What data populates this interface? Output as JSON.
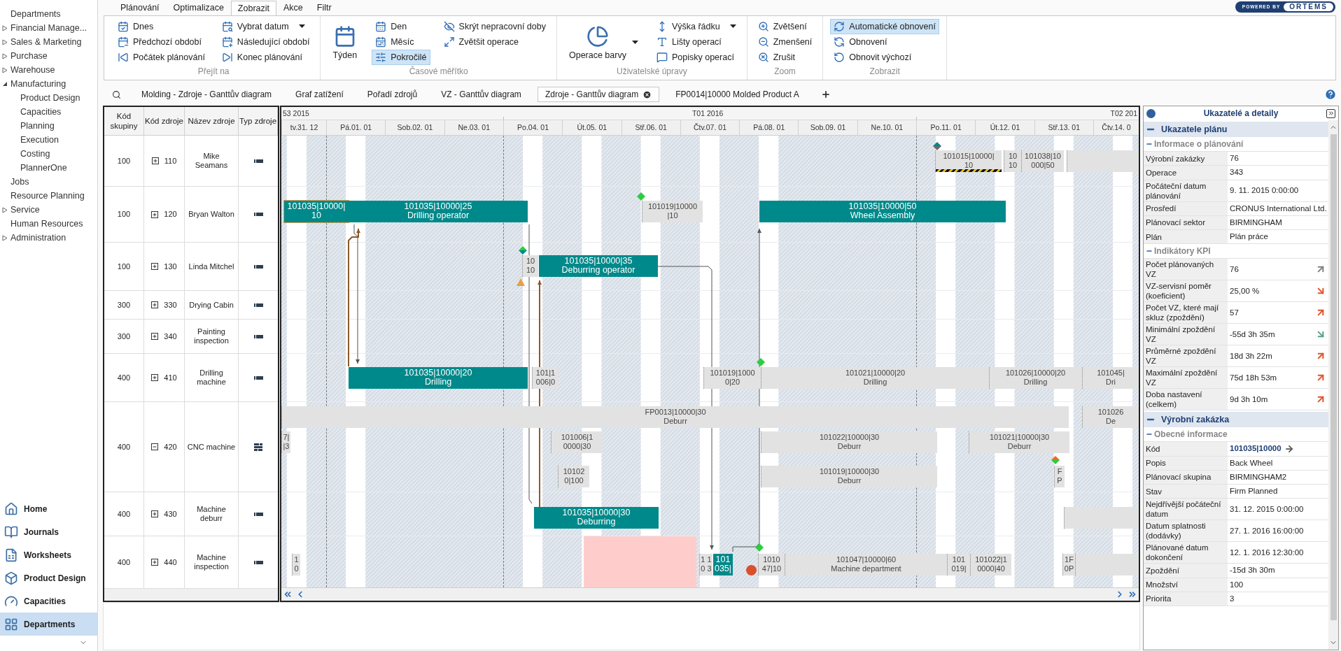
{
  "sidebar": {
    "items": [
      {
        "label": "Departments"
      },
      {
        "label": "Financial Manage...",
        "expanded": false
      },
      {
        "label": "Sales & Marketing",
        "expanded": false
      },
      {
        "label": "Purchase",
        "expanded": false
      },
      {
        "label": "Warehouse",
        "expanded": false
      },
      {
        "label": "Manufacturing",
        "expanded": true,
        "children": [
          {
            "label": "Product Design"
          },
          {
            "label": "Capacities"
          },
          {
            "label": "Planning"
          },
          {
            "label": "Execution"
          },
          {
            "label": "Costing"
          },
          {
            "label": "PlannerOne"
          }
        ]
      },
      {
        "label": "Jobs"
      },
      {
        "label": "Resource Planning"
      },
      {
        "label": "Service",
        "expanded": false
      },
      {
        "label": "Human Resources"
      },
      {
        "label": "Administration",
        "expanded": false
      }
    ],
    "nav_buttons": [
      {
        "label": "Home",
        "selected": false
      },
      {
        "label": "Journals",
        "selected": false
      },
      {
        "label": "Worksheets",
        "selected": false
      },
      {
        "label": "Product Design",
        "selected": false
      },
      {
        "label": "Capacities",
        "selected": false
      },
      {
        "label": "Departments",
        "selected": true
      }
    ]
  },
  "ribbon": {
    "tabs": [
      {
        "label": "Plánování",
        "selected": false
      },
      {
        "label": "Optimalizace",
        "selected": false
      },
      {
        "label": "Zobrazit",
        "selected": true
      },
      {
        "label": "Akce",
        "selected": false
      },
      {
        "label": "Filtr",
        "selected": false
      }
    ],
    "logo": {
      "tagline": "POWERED BY",
      "brand": "ORTEMS"
    },
    "groups": [
      {
        "title": "Přejít na",
        "items": [
          {
            "label": "Dnes",
            "kind": "small",
            "selected": false,
            "dropdown": false
          },
          {
            "label": "Předchozí období",
            "kind": "small",
            "selected": false,
            "dropdown": false
          },
          {
            "label": "Počátek plánování",
            "kind": "small",
            "selected": false,
            "dropdown": false
          },
          {
            "label": "Vybrat datum",
            "kind": "small",
            "selected": false,
            "dropdown": true
          },
          {
            "label": "Následující období",
            "kind": "small",
            "selected": false,
            "dropdown": false
          },
          {
            "label": "Konec plánování",
            "kind": "small",
            "selected": false,
            "dropdown": false
          }
        ]
      },
      {
        "title": "Časové měřítko",
        "items": [
          {
            "label": "Týden",
            "kind": "large",
            "selected": false,
            "dropdown": false
          },
          {
            "label": "Den",
            "kind": "small",
            "selected": false,
            "dropdown": false
          },
          {
            "label": "Měsíc",
            "kind": "small",
            "selected": false,
            "dropdown": false
          },
          {
            "label": "Pokročilé",
            "kind": "small",
            "selected": true,
            "dropdown": false
          },
          {
            "label": "Skrýt nepracovní doby",
            "kind": "small",
            "selected": false,
            "dropdown": false
          },
          {
            "label": "Zvětšit operace",
            "kind": "small",
            "selected": false,
            "dropdown": false
          }
        ]
      },
      {
        "title": "Uživatelské úpravy",
        "items": [
          {
            "label": "Operace barvy",
            "kind": "large",
            "selected": false,
            "dropdown": true
          },
          {
            "label": "Výška řádku",
            "kind": "small",
            "selected": false,
            "dropdown": true
          },
          {
            "label": "Lišty operací",
            "kind": "small",
            "selected": false,
            "dropdown": false
          },
          {
            "label": "Popisky operací",
            "kind": "small",
            "selected": false,
            "dropdown": false
          }
        ]
      },
      {
        "title": "Zoom",
        "items": [
          {
            "label": "Zvětšení",
            "kind": "small",
            "selected": false,
            "dropdown": false
          },
          {
            "label": "Zmenšení",
            "kind": "small",
            "selected": false,
            "dropdown": false
          },
          {
            "label": "Zrušit",
            "kind": "small",
            "selected": false,
            "dropdown": false
          }
        ]
      },
      {
        "title": "Zobrazit",
        "items": [
          {
            "label": "Automatické obnovení",
            "kind": "small",
            "selected": true,
            "dropdown": false
          },
          {
            "label": "Obnovení",
            "kind": "small",
            "selected": false,
            "dropdown": false
          },
          {
            "label": "Obnovit výchozí",
            "kind": "small",
            "selected": false,
            "dropdown": false
          }
        ]
      }
    ]
  },
  "doc_tabs": [
    {
      "label": "Molding - Zdroje - Ganttův diagram",
      "selected": false
    },
    {
      "label": "Graf zatížení",
      "selected": false
    },
    {
      "label": "Pořadí zdrojů",
      "selected": false
    },
    {
      "label": "VZ - Ganttův diagram",
      "selected": false
    },
    {
      "label": "Zdroje - Ganttův diagram",
      "selected": true
    },
    {
      "label": "FP0014|10000 Molded Product A",
      "selected": false
    }
  ],
  "gantt": {
    "columns": [
      "Kód skupiny",
      "Kód zdroje",
      "Název zdroje",
      "Typ zdroje"
    ],
    "weeks": [
      "53 2015",
      "T01 2016",
      "T02 201"
    ],
    "days": [
      "tv.31. 12",
      "Pá.01. 01",
      "Sob.02. 01",
      "Ne.03. 01",
      "Po.04. 01",
      "Út.05. 01",
      "Stř.06. 01",
      "Čtv.07. 01",
      "Pá.08. 01",
      "Sob.09. 01",
      "Ne.10. 01",
      "Po.11. 01",
      "Út.12. 01",
      "Stř.13. 01",
      "Čtv.14. 0"
    ],
    "rows": [
      {
        "group": "100",
        "code": "110",
        "name": "Mike Seamans",
        "kind": "single",
        "expanded": false,
        "bars": [
          {
            "lines": [
              "101015|10000|",
              "10"
            ],
            "kind": "other",
            "selected": false,
            "delayed": true
          },
          {
            "lines": [
              "10",
              "10"
            ],
            "kind": "other",
            "selected": false,
            "delayed": false
          },
          {
            "lines": [
              "101038|10",
              "000|50"
            ],
            "kind": "other",
            "selected": false,
            "delayed": false
          },
          {
            "kind": "other",
            "selected": false,
            "delayed": false
          }
        ]
      },
      {
        "group": "100",
        "code": "120",
        "name": "Bryan Walton",
        "kind": "single",
        "expanded": false,
        "bars": [
          {
            "lines": [
              "101035|10000|",
              "10"
            ],
            "kind": "order",
            "selected": true,
            "delayed": false
          },
          {
            "lines": [
              "101035|10000|25",
              "Drilling operator"
            ],
            "kind": "order",
            "selected": false,
            "delayed": false
          },
          {
            "lines": [
              "101019|10000",
              "|10"
            ],
            "kind": "other",
            "selected": false,
            "delayed": false
          },
          {
            "lines": [
              "101035|10000|50",
              "Wheel Assembly"
            ],
            "kind": "order",
            "selected": false,
            "delayed": false
          }
        ]
      },
      {
        "group": "100",
        "code": "130",
        "name": "Linda Mitchel",
        "kind": "single",
        "expanded": false,
        "bars": [
          {
            "lines": [
              "10",
              "10"
            ],
            "kind": "other",
            "selected": false,
            "delayed": false
          },
          {
            "lines": [
              "101035|10000|35",
              "Deburring operator"
            ],
            "kind": "order",
            "selected": false,
            "delayed": false
          }
        ]
      },
      {
        "group": "300",
        "code": "330",
        "name": "Drying Cabin",
        "kind": "single",
        "expanded": false
      },
      {
        "group": "300",
        "code": "340",
        "name": "Painting inspection",
        "kind": "single",
        "expanded": false
      },
      {
        "group": "400",
        "code": "410",
        "name": "Drilling machine",
        "kind": "single",
        "expanded": false,
        "bars": [
          {
            "lines": [
              "101035|10000|20",
              "Drilling"
            ],
            "kind": "order",
            "selected": false,
            "delayed": false
          },
          {
            "lines": [
              "101|1",
              "006|0"
            ],
            "kind": "other",
            "selected": false,
            "delayed": false
          },
          {
            "lines": [
              "101019|1000",
              "0|20"
            ],
            "kind": "other",
            "selected": false,
            "delayed": false
          },
          {
            "lines": [
              "101021|10000|20",
              "Drilling"
            ],
            "kind": "other",
            "selected": false,
            "delayed": false
          },
          {
            "lines": [
              "101026|10000|20",
              "Drilling"
            ],
            "kind": "other",
            "selected": false,
            "delayed": false
          },
          {
            "lines": [
              "101045|",
              "Dri"
            ],
            "kind": "other",
            "selected": false,
            "delayed": false
          }
        ]
      },
      {
        "group": "400",
        "code": "420",
        "name": "CNC machine",
        "kind": "multiple",
        "expanded": true,
        "bars": [
          {
            "lines": [
              "FP0013|10000|30",
              "Deburr"
            ],
            "kind": "other",
            "selected": false,
            "delayed": false
          },
          {
            "lines": [
              "101026",
              "De"
            ],
            "kind": "other",
            "selected": false,
            "delayed": false
          },
          {
            "lines": [
              "7|",
              "|3"
            ],
            "kind": "other",
            "selected": false,
            "delayed": false
          },
          {
            "lines": [
              "101006|1",
              "0000|30"
            ],
            "kind": "other",
            "selected": false,
            "delayed": false
          },
          {
            "lines": [
              "101022|10000|30",
              "Deburr"
            ],
            "kind": "other",
            "selected": false,
            "delayed": false
          },
          {
            "lines": [
              "101021|10000|30",
              "Deburr"
            ],
            "kind": "other",
            "selected": false,
            "delayed": false
          },
          {
            "lines": [
              "10102",
              "0|100"
            ],
            "kind": "other",
            "selected": false,
            "delayed": false
          },
          {
            "lines": [
              "101019|10000|30",
              "Deburr"
            ],
            "kind": "other",
            "selected": false,
            "delayed": false
          },
          {
            "lines": [
              "F",
              "P"
            ],
            "kind": "other",
            "selected": false,
            "delayed": false
          }
        ]
      },
      {
        "group": "400",
        "code": "430",
        "name": "Machine deburr",
        "kind": "single",
        "expanded": false,
        "bars": [
          {
            "lines": [
              "101035|10000|30",
              "Deburring"
            ],
            "kind": "order",
            "selected": false,
            "delayed": false
          },
          {
            "kind": "other",
            "selected": false,
            "delayed": false
          }
        ]
      },
      {
        "group": "400",
        "code": "440",
        "name": "Machine inspection",
        "kind": "single",
        "expanded": false,
        "bars": [
          {
            "lines": [
              "1",
              "0"
            ],
            "kind": "other",
            "selected": false,
            "delayed": false
          },
          {
            "lines": [
              "1 1",
              "0 3"
            ],
            "kind": "other",
            "selected": false,
            "delayed": false
          },
          {
            "lines": [
              "101",
              "035|"
            ],
            "kind": "order",
            "selected": false,
            "delayed": false
          },
          {
            "lines": [
              "1010",
              "47|10"
            ],
            "kind": "other",
            "selected": false,
            "delayed": false
          },
          {
            "lines": [
              "101047|10000|60",
              "Machine department"
            ],
            "kind": "other",
            "selected": false,
            "delayed": false
          },
          {
            "lines": [
              "101",
              "019|"
            ],
            "kind": "other",
            "selected": false,
            "delayed": false
          },
          {
            "lines": [
              "101022|1",
              "0000|40"
            ],
            "kind": "other",
            "selected": false,
            "delayed": false
          },
          {
            "lines": [
              "1F",
              "0P"
            ],
            "kind": "other",
            "selected": false,
            "delayed": false
          },
          {
            "kind": "other",
            "selected": false,
            "delayed": false
          }
        ]
      }
    ]
  },
  "details_panel": {
    "title": "Ukazatelé a detaily",
    "sections": [
      {
        "title": "Ukazatele plánu",
        "groups": [
          {
            "title": "Informace o plánování",
            "rows": [
              {
                "label": "Výrobní zakázky",
                "value": "76",
                "kind": "text"
              },
              {
                "label": "Operace",
                "value": "343",
                "kind": "text"
              },
              {
                "label": "Počáteční datum plánování",
                "value": "9. 11. 2015 0:00:00",
                "kind": "text"
              },
              {
                "label": "Prosředí",
                "value": "CRONUS International Ltd.",
                "kind": "text"
              },
              {
                "label": "Plánovací sektor",
                "value": "BIRMINGHAM",
                "kind": "text"
              },
              {
                "label": "Plán",
                "value": "Plán práce",
                "kind": "text"
              }
            ]
          },
          {
            "title": "Indikátory KPI",
            "rows": [
              {
                "label": "Počet plánovaných VZ",
                "value": "76",
                "kind": "kpi",
                "rising": true,
                "color": "#808080"
              },
              {
                "label": "VZ-servisní poměr (koeficient)",
                "value": "25,00 %",
                "kind": "kpi",
                "rising": false,
                "color": "#e0522a"
              },
              {
                "label": "Počet VZ, které mají skluz (zpoždění)",
                "value": "57",
                "kind": "kpi",
                "rising": true,
                "color": "#e0522a"
              },
              {
                "label": "Minimální zpoždění VZ",
                "value": "-55d 3h 35m",
                "kind": "kpi",
                "rising": false,
                "color": "#5a9e83"
              },
              {
                "label": "Průměrné zpoždění VZ",
                "value": "18d 3h 22m",
                "kind": "kpi",
                "rising": true,
                "color": "#e0522a"
              },
              {
                "label": "Maximální zpoždění VZ",
                "value": "75d 18h 53m",
                "kind": "kpi",
                "rising": true,
                "color": "#e0522a"
              },
              {
                "label": "Doba nastavení (celkem)",
                "value": "9d 3h 10m",
                "kind": "kpi",
                "rising": true,
                "color": "#e0522a"
              }
            ]
          }
        ]
      },
      {
        "title": "Výrobní zakázka",
        "groups": [
          {
            "title": "Obecné informace",
            "rows": [
              {
                "label": "Kód",
                "value": "101035|10000",
                "kind": "link"
              },
              {
                "label": "Popis",
                "value": "Back Wheel",
                "kind": "text"
              },
              {
                "label": "Plánovací skupina",
                "value": "BIRMINGHAM2",
                "kind": "text"
              },
              {
                "label": "Stav",
                "value": "Firm Planned",
                "kind": "text"
              },
              {
                "label": "Nejdřívější počáteční datum",
                "value": "31. 12. 2015 0:00:00",
                "kind": "text"
              },
              {
                "label": "Datum splatnosti (dodávky)",
                "value": "27. 1. 2016 16:00:00",
                "kind": "text"
              },
              {
                "label": "Plánované datum dokončení",
                "value": "12. 1. 2016 12:30:00",
                "kind": "text"
              },
              {
                "label": "Zpoždění",
                "value": "-15d 3h 30m",
                "kind": "text"
              },
              {
                "label": "Množství",
                "value": "100",
                "kind": "text"
              },
              {
                "label": "Priorita",
                "value": "3",
                "kind": "text"
              }
            ]
          }
        ]
      }
    ]
  }
}
